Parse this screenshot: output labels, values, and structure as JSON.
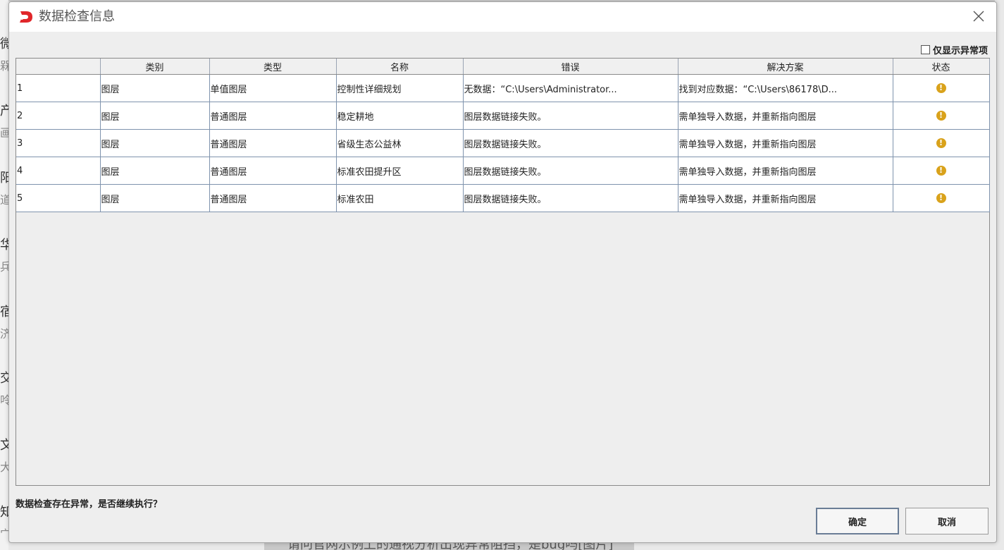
{
  "dialog": {
    "title": "数据检查信息",
    "only_abnormal_label": "仅显示异常项",
    "columns": [
      "",
      "类别",
      "类型",
      "名称",
      "错误",
      "解决方案",
      "状态"
    ],
    "rows": [
      {
        "index": "1",
        "category": "图层",
        "type": "单值图层",
        "name": "控制性详细规划",
        "error": "无数据：“C:\\Users\\Administrator...",
        "solution": "找到对应数据：“C:\\Users\\86178\\D...",
        "status_icon": "warning-icon"
      },
      {
        "index": "2",
        "category": "图层",
        "type": "普通图层",
        "name": "稳定耕地",
        "error": "图层数据链接失败。",
        "solution": "需单独导入数据，并重新指向图层",
        "status_icon": "warning-icon"
      },
      {
        "index": "3",
        "category": "图层",
        "type": "普通图层",
        "name": "省级生态公益林",
        "error": "图层数据链接失败。",
        "solution": "需单独导入数据，并重新指向图层",
        "status_icon": "warning-icon"
      },
      {
        "index": "4",
        "category": "图层",
        "type": "普通图层",
        "name": "标准农田提升区",
        "error": "图层数据链接失败。",
        "solution": "需单独导入数据，并重新指向图层",
        "status_icon": "warning-icon"
      },
      {
        "index": "5",
        "category": "图层",
        "type": "普通图层",
        "name": "标准农田",
        "error": "图层数据链接失败。",
        "solution": "需单独导入数据，并重新指向图层",
        "status_icon": "warning-icon"
      }
    ],
    "prompt": "数据检查存在异常，是否继续执行？",
    "ok_label": "确定",
    "cancel_label": "取消"
  },
  "background": {
    "left_chars": [
      "微",
      "槑",
      "产",
      "画",
      "阳",
      "道",
      "华",
      "兵",
      "宿",
      "济",
      "交",
      "呤",
      "文",
      "大",
      "知",
      "宀"
    ],
    "bottom_text": "请问官网示例上的通视分析出现异常阻挡，是bug吗[图片]"
  },
  "colors": {
    "accent_logo": "#e0262a",
    "warning": "#d9a21b"
  }
}
